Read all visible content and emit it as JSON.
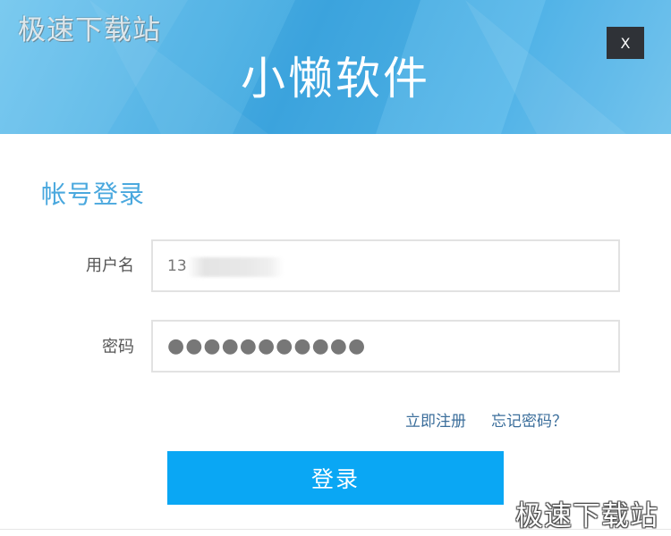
{
  "header": {
    "title": "小懒软件",
    "close_label": "X",
    "background_colors": [
      "#6cc4ee",
      "#3fa8e0",
      "#56b7ea",
      "#79c9f0"
    ]
  },
  "watermark": {
    "top": "极速下载站",
    "bottom": "极速下载站"
  },
  "login": {
    "section_title": "帐号登录",
    "username_label": "用户名",
    "username_value": "13",
    "password_label": "密码",
    "password_value": "●●●●●●●●●●●",
    "register_link": "立即注册",
    "forgot_link": "忘记密码？",
    "submit_label": "登录"
  },
  "colors": {
    "accent": "#0aa7f4",
    "section_title": "#4aa8de",
    "link": "#3b6e9b",
    "close_bg": "#2f3237"
  }
}
